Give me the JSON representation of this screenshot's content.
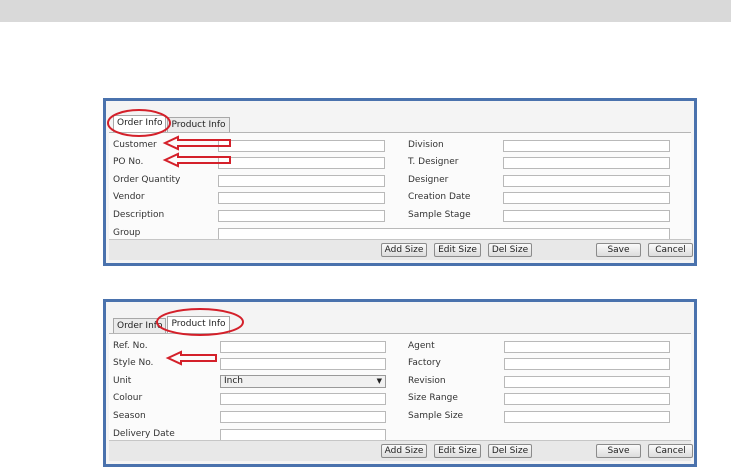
{
  "tabs": {
    "order": "Order Info",
    "product": "Product Info"
  },
  "order_form": {
    "customer": "Customer",
    "po_no": "PO No.",
    "order_quantity": "Order Quantity",
    "vendor": "Vendor",
    "description": "Description",
    "group": "Group",
    "division": "Division",
    "t_designer": "T. Designer",
    "designer": "Designer",
    "creation_date": "Creation Date",
    "sample_stage": "Sample Stage"
  },
  "product_form": {
    "ref_no": "Ref. No.",
    "style_no": "Style No.",
    "unit": "Unit",
    "unit_value": "Inch",
    "colour": "Colour",
    "season": "Season",
    "delivery_date": "Delivery Date",
    "agent": "Agent",
    "factory": "Factory",
    "revision": "Revision",
    "size_range": "Size Range",
    "sample_size": "Sample Size"
  },
  "buttons": {
    "add_size": "Add Size",
    "edit_size": "Edit Size",
    "del_size": "Del Size",
    "save": "Save",
    "cancel": "Cancel"
  },
  "annotation_color": "#d4202a",
  "icons": {
    "dropdown": "chevron-down-icon",
    "arrow": "left-arrow-icon",
    "highlight": "ellipse-highlight"
  }
}
